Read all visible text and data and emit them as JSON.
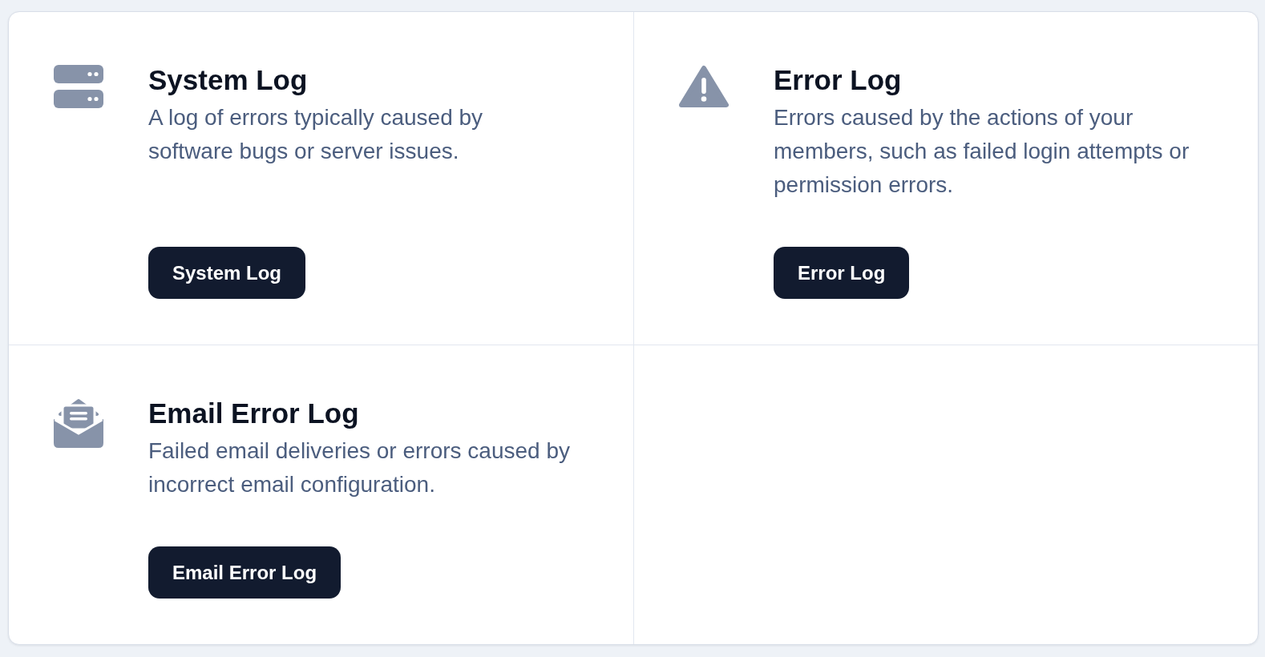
{
  "cards": [
    {
      "kind": "server",
      "title": "System Log",
      "description": "A log of errors typically caused by software bugs or server issues.",
      "button": "System Log"
    },
    {
      "kind": "warning",
      "title": "Error Log",
      "description": "Errors caused by the actions of your members, such as failed login attempts or permission errors.",
      "button": "Error Log"
    },
    {
      "kind": "mail",
      "title": "Email Error Log",
      "description": "Failed email deliveries or errors caused by incorrect email configuration.",
      "button": "Email Error Log"
    }
  ]
}
